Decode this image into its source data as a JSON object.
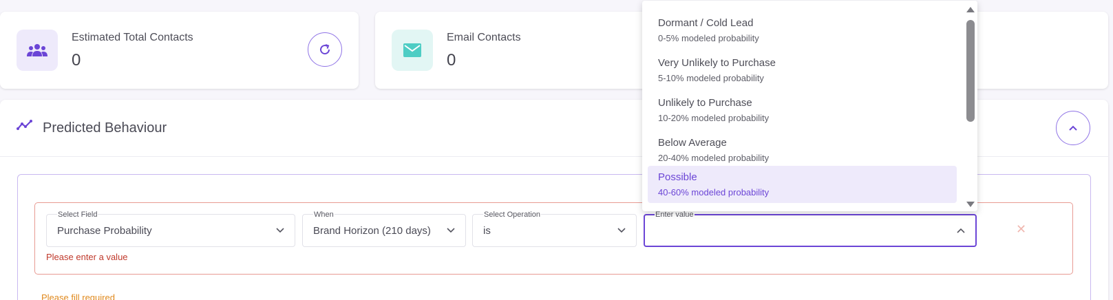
{
  "stats": {
    "total": {
      "label": "Estimated Total Contacts",
      "value": "0",
      "icon": "users-icon"
    },
    "email": {
      "label": "Email Contacts",
      "value": "0",
      "icon": "mail-icon"
    }
  },
  "section": {
    "title": "Predicted Behaviour",
    "icon": "trend-icon"
  },
  "rule": {
    "field": {
      "label": "Select Field",
      "value": "Purchase Probability"
    },
    "when": {
      "label": "When",
      "value": "Brand Horizon (210 days)"
    },
    "operation": {
      "label": "Select Operation",
      "value": "is"
    },
    "value": {
      "label": "Enter value",
      "value": ""
    },
    "error": "Please enter a value",
    "remove_glyph": "✕"
  },
  "group_warning": "Please fill required",
  "dropdown": {
    "options": [
      {
        "title": "Dormant / Cold Lead",
        "sub": "0-5% modeled probability"
      },
      {
        "title": "Very Unlikely to Purchase",
        "sub": "5-10% modeled probability"
      },
      {
        "title": "Unlikely to Purchase",
        "sub": "10-20% modeled probability"
      },
      {
        "title": "Below Average",
        "sub": "20-40% modeled probability"
      },
      {
        "title": "Possible",
        "sub": "40-60% modeled probability"
      }
    ],
    "selected_index": 4
  },
  "colors": {
    "accent": "#6b45d6",
    "teal": "#4ecdc4",
    "error": "#c0392b",
    "warning": "#e0891d"
  }
}
